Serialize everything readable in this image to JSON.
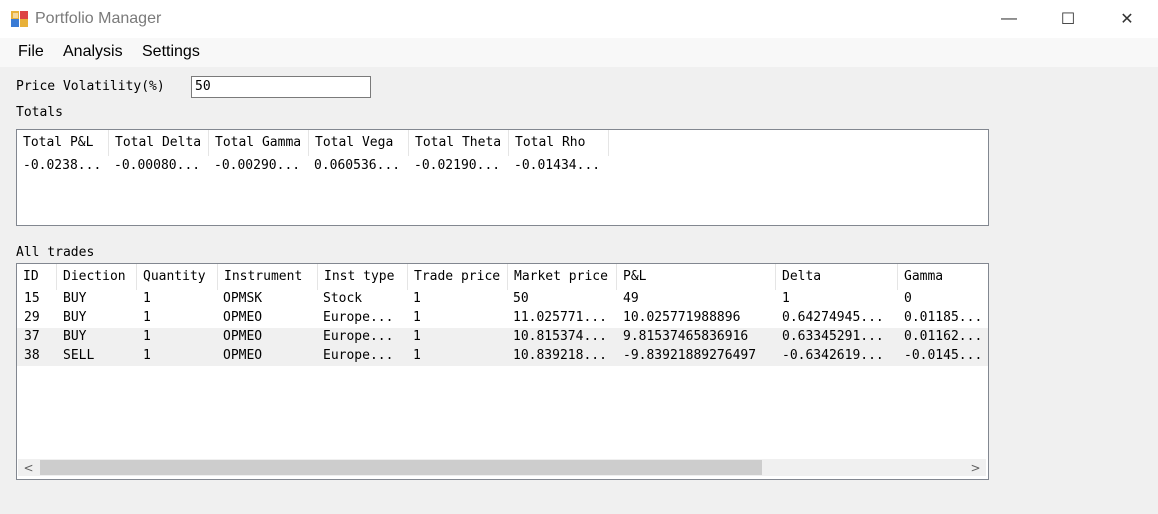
{
  "window": {
    "title": "Portfolio Manager",
    "minimize_glyph": "—",
    "maximize_glyph": "☐",
    "close_glyph": "✕"
  },
  "menu": [
    "File",
    "Analysis",
    "Settings"
  ],
  "volatility": {
    "label": "Price Volatility(%)",
    "value": "50"
  },
  "totals": {
    "label": "Totals",
    "headers": [
      "Total P&L",
      "Total Delta",
      "Total Gamma",
      "Total Vega",
      "Total Theta",
      "Total Rho"
    ],
    "values": [
      "-0.0238...",
      "-0.00080...",
      "-0.00290...",
      "0.060536...",
      "-0.02190...",
      "-0.01434..."
    ]
  },
  "trades": {
    "label": "All trades",
    "headers": [
      "ID",
      "Diection",
      "Quantity",
      "Instrument",
      "Inst type",
      "Trade price",
      "Market price",
      "P&L",
      "Delta",
      "Gamma"
    ],
    "rows": [
      [
        "15",
        "BUY",
        "1",
        "OPMSK",
        "Stock",
        "1",
        "50",
        "49",
        "1",
        "0"
      ],
      [
        "29",
        "BUY",
        "1",
        "OPMEO",
        "Europe...",
        "1",
        "11.025771...",
        "10.025771988896",
        "0.64274945...",
        "0.01185..."
      ],
      [
        "37",
        "BUY",
        "1",
        "OPMEO",
        "Europe...",
        "1",
        "10.815374...",
        "9.81537465836916",
        "0.63345291...",
        "0.01162..."
      ],
      [
        "38",
        "SELL",
        "1",
        "OPMEO",
        "Europe...",
        "1",
        "10.839218...",
        "-9.83921889276497",
        "-0.6342619...",
        "-0.0145..."
      ]
    ],
    "scroll_left_glyph": "<",
    "scroll_right_glyph": ">"
  }
}
